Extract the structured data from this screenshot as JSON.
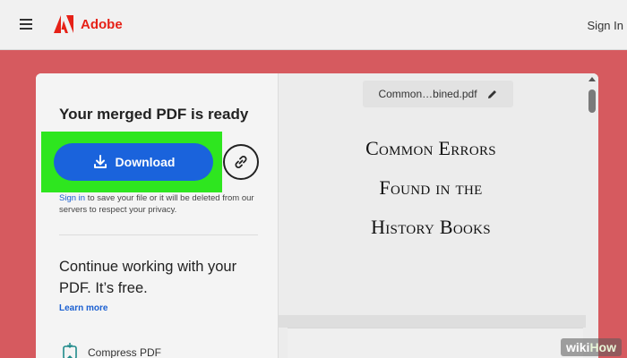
{
  "header": {
    "brand": "Adobe",
    "sign_in": "Sign In",
    "menu_icon": "hamburger-icon",
    "logo_icon": "adobe-logo-icon"
  },
  "left_panel": {
    "title": "Your merged PDF is ready",
    "download_label": "Download",
    "download_icon": "download-icon",
    "link_icon": "link-icon",
    "note_link": "Sign in",
    "note_text": " to save your file or it will be deleted from our servers to respect your privacy.",
    "continue_title": "Continue working with your PDF. It’s free.",
    "learn_more": "Learn more",
    "tools": [
      {
        "label": "Compress PDF",
        "icon": "compress-pdf-icon"
      }
    ]
  },
  "preview": {
    "filename": "Common…bined.pdf",
    "edit_icon": "pencil-icon",
    "doc_title_lines": [
      "Common Errors",
      "Found in the",
      "History Books"
    ]
  },
  "watermark": {
    "wiki": "wiki",
    "how": "How"
  },
  "colors": {
    "accent_blue": "#1a63dc",
    "highlight_green": "#2ee61f",
    "adobe_red": "#e62117",
    "background_red": "#d65a5f"
  }
}
